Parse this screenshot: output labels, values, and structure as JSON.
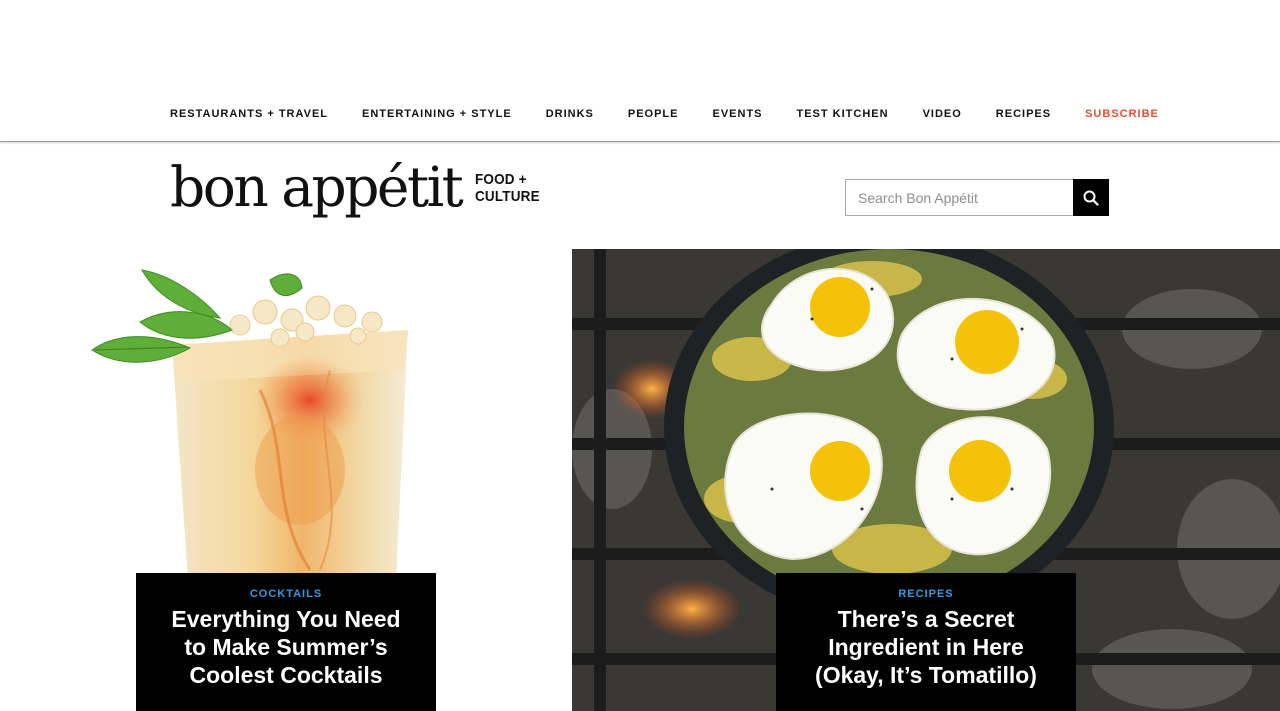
{
  "nav": {
    "items": [
      {
        "label": "RESTAURANTS + TRAVEL"
      },
      {
        "label": "ENTERTAINING + STYLE"
      },
      {
        "label": "DRINKS"
      },
      {
        "label": "PEOPLE"
      },
      {
        "label": "EVENTS"
      },
      {
        "label": "TEST KITCHEN"
      },
      {
        "label": "VIDEO"
      },
      {
        "label": "RECIPES"
      }
    ],
    "subscribe": "SUBSCRIBE",
    "subscribe_color": "#e0522d"
  },
  "logo": {
    "wordmark": "bon appétit",
    "tag_line1": "FOOD +",
    "tag_line2": "CULTURE"
  },
  "search": {
    "placeholder": "Search Bon Appétit",
    "value": "",
    "icon": "search-icon"
  },
  "features": [
    {
      "kicker": "COCKTAILS",
      "headline": "Everything You Need\nto Make Summer’s\nCoolest Cocktails",
      "image": "cocktail-glass-with-mint"
    },
    {
      "kicker": "RECIPES",
      "headline": "There’s a Secret\nIngredient in Here\n(Okay, It’s Tomatillo)",
      "image": "skillet-with-fried-eggs-over-fire"
    }
  ],
  "colors": {
    "kicker": "#2f9be9",
    "caption_bg": "#000000"
  }
}
